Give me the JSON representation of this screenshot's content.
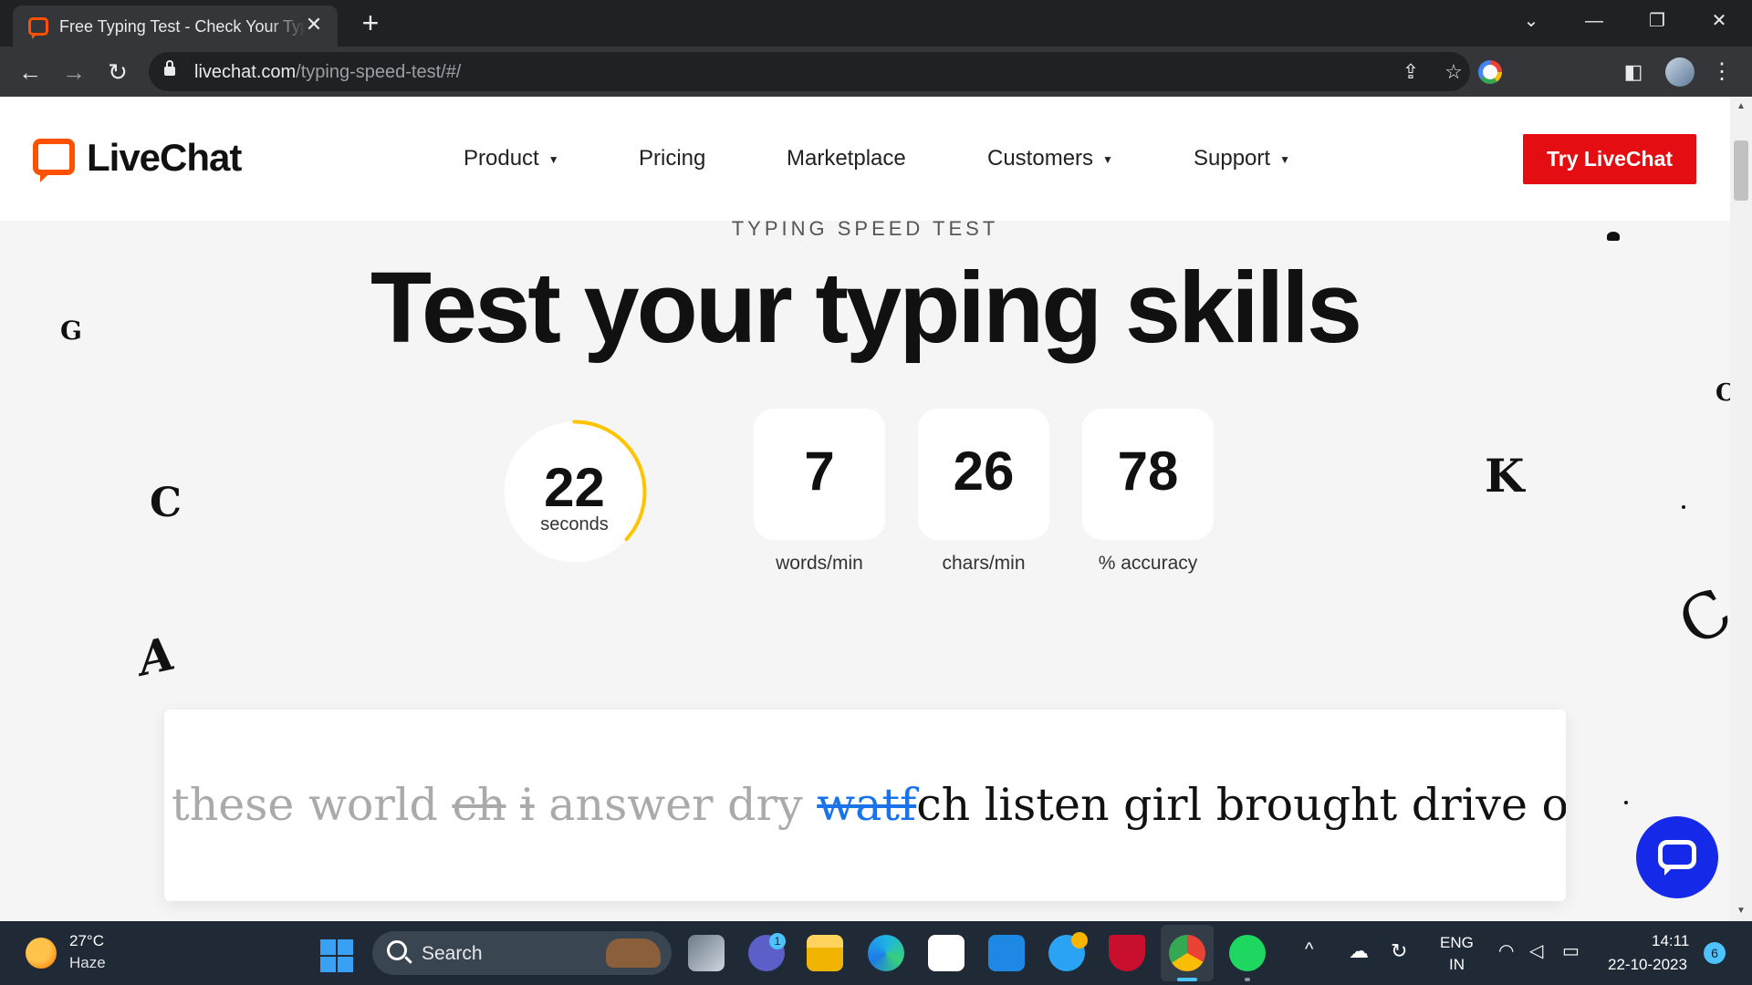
{
  "browser": {
    "tab_title": "Free Typing Test - Check Your Typing Speed",
    "url_domain": "livechat.com",
    "url_path": "/typing-speed-test/#/"
  },
  "header": {
    "logo_text": "LiveChat",
    "nav": [
      {
        "label": "Product",
        "has_dropdown": true
      },
      {
        "label": "Pricing",
        "has_dropdown": false
      },
      {
        "label": "Marketplace",
        "has_dropdown": false
      },
      {
        "label": "Customers",
        "has_dropdown": true
      },
      {
        "label": "Support",
        "has_dropdown": true
      }
    ],
    "cta_label": "Try LiveChat"
  },
  "hero": {
    "eyebrow": "TYPING SPEED TEST",
    "title": "Test your typing skills"
  },
  "stats": {
    "timer_value": "22",
    "timer_unit": "seconds",
    "timer_remaining_fraction": 0.367,
    "words_per_min": "7",
    "words_label": "words/min",
    "chars_per_min": "26",
    "chars_label": "chars/min",
    "accuracy": "78",
    "accuracy_label": "% accuracy"
  },
  "typing": {
    "done_1": "these world ",
    "wrong_1": "ch",
    "space_1": " ",
    "wrong_2": "i",
    "done_2": " answer dry ",
    "current_typed": "watf",
    "current_rest": "ch listen girl brought drive order"
  },
  "decor_letters": [
    "G",
    "C",
    "A",
    "K",
    "C",
    "C"
  ],
  "colors": {
    "brand_orange": "#ff5100",
    "cta_red": "#e40d12",
    "timer_ring": "#ffc400",
    "chat_blue": "#1529e8",
    "current_word_blue": "#1a73e8"
  },
  "taskbar": {
    "weather_temp": "27°C",
    "weather_desc": "Haze",
    "search_label": "Search",
    "teams_badge": "1",
    "lang_line1": "ENG",
    "lang_line2": "IN",
    "time": "14:11",
    "date": "22-10-2023",
    "notifications": "6"
  }
}
